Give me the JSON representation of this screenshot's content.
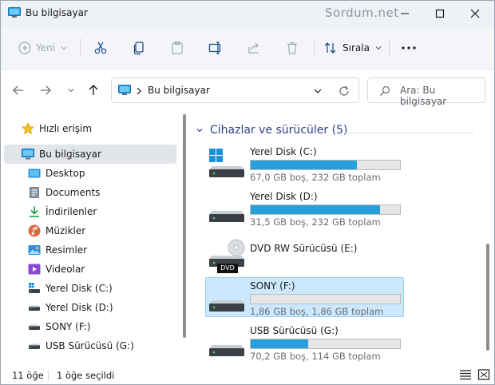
{
  "window": {
    "title": "Bu bilgisayar",
    "watermark": "Sordum.net"
  },
  "toolbar": {
    "new_label": "Yeni",
    "sort_label": "Sırala",
    "buttons": [
      "cut-icon",
      "copy-icon",
      "paste-icon",
      "rename-icon",
      "share-icon",
      "delete-icon"
    ],
    "more": "more-icon"
  },
  "address": {
    "path": "Bu bilgisayar",
    "search_placeholder": "Ara: Bu bilgisayar"
  },
  "sidebar": {
    "items": [
      {
        "label": "Hızlı erişim",
        "icon": "star-icon"
      },
      {
        "label": "Bu bilgisayar",
        "icon": "computer-icon"
      },
      {
        "label": "Desktop",
        "icon": "desktop-icon"
      },
      {
        "label": "Documents",
        "icon": "documents-icon"
      },
      {
        "label": "İndirilenler",
        "icon": "download-icon"
      },
      {
        "label": "Müzikler",
        "icon": "music-icon"
      },
      {
        "label": "Resimler",
        "icon": "pictures-icon"
      },
      {
        "label": "Videolar",
        "icon": "videos-icon"
      },
      {
        "label": "Yerel Disk (C:)",
        "icon": "drive-icon"
      },
      {
        "label": "Yerel Disk (D:)",
        "icon": "drive-icon"
      },
      {
        "label": "SONY (F:)",
        "icon": "drive-icon"
      },
      {
        "label": "USB Sürücüsü (G:)",
        "icon": "drive-icon"
      }
    ]
  },
  "content": {
    "group_title": "Cihazlar ve sürücüler (5)",
    "drives": [
      {
        "name": "Yerel Disk (C:)",
        "detail": "67,0 GB boş, 232 GB toplam",
        "used_fraction": 0.711,
        "icon": "windows-drive-icon"
      },
      {
        "name": "Yerel Disk (D:)",
        "detail": "31,5 GB boş, 232 GB toplam",
        "used_fraction": 0.864,
        "icon": "drive-icon"
      },
      {
        "name": "DVD RW Sürücüsü (E:)",
        "detail": "",
        "used_fraction": null,
        "icon": "dvd-drive-icon",
        "badge": "DVD"
      },
      {
        "name": "SONY (F:)",
        "detail": "1,86 GB boş, 1,86 GB toplam",
        "used_fraction": 0.0,
        "icon": "drive-icon"
      },
      {
        "name": "USB Sürücüsü (G:)",
        "detail": "70,2 GB boş, 114 GB toplam",
        "used_fraction": 0.384,
        "icon": "drive-icon"
      }
    ]
  },
  "status": {
    "count": "11 öğe",
    "selected": "1 öğe seçildi"
  },
  "colors": {
    "accent": "#26a0da",
    "selection": "#cce8ff",
    "group_title": "#2c3e8c"
  }
}
